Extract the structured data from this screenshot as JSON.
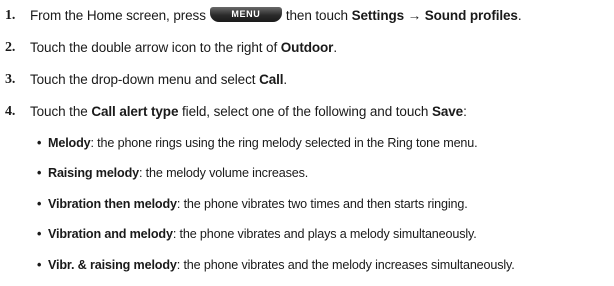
{
  "steps": [
    {
      "number": "1.",
      "part1": "From the Home screen, press",
      "key_label": "MENU",
      "part2": "then touch",
      "bold1": "Settings → Sound profiles",
      "part3": "."
    },
    {
      "number": "2.",
      "part1": "Touch the double arrow icon to the right of",
      "bold1": "Outdoor",
      "part2": "."
    },
    {
      "number": "3.",
      "part1": "Touch the drop-down menu and select",
      "bold1": "Call",
      "part2": "."
    },
    {
      "number": "4.",
      "part1": "Touch the",
      "bold1": "Call alert type",
      "part2": "field, select one of the following and touch",
      "bold2": "Save",
      "part3": ":"
    }
  ],
  "bullets": [
    {
      "term": "Melody",
      "desc": ": the phone rings using the ring melody selected in the Ring tone menu."
    },
    {
      "term": "Raising melody",
      "desc": ": the melody volume increases."
    },
    {
      "term": "Vibration then melody",
      "desc": ": the phone vibrates two times and then starts ringing."
    },
    {
      "term": "Vibration and melody",
      "desc": ": the phone vibrates and plays a melody simultaneously."
    },
    {
      "term": "Vibr. & raising melody",
      "desc": ": the phone vibrates and the melody increases simultaneously."
    }
  ]
}
